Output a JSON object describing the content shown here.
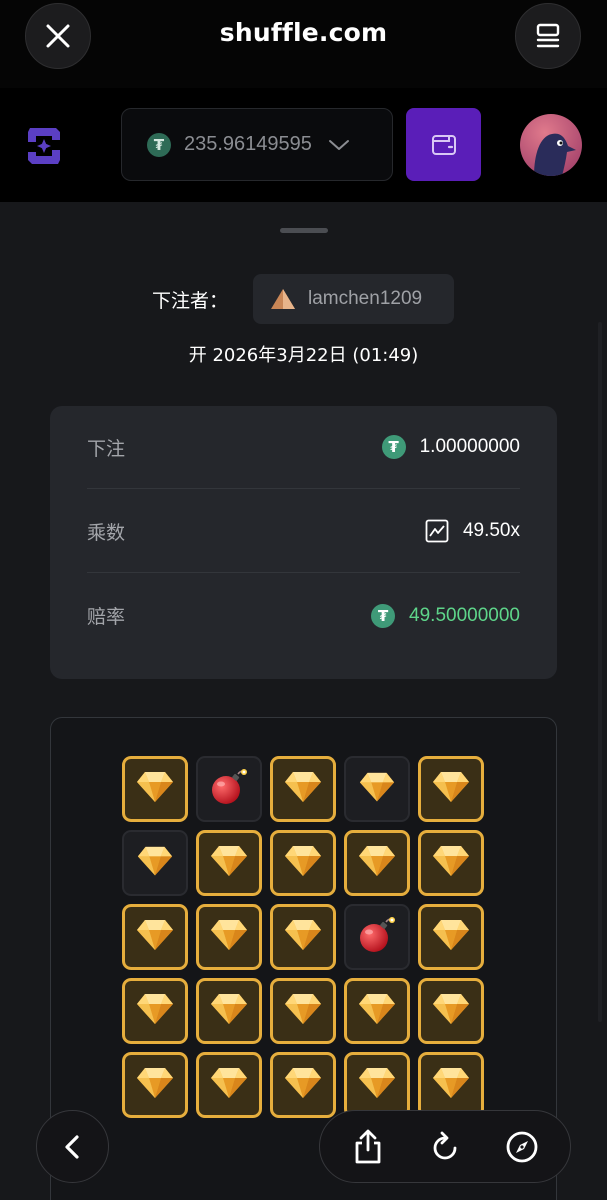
{
  "browser": {
    "url": "shuffle.com"
  },
  "header": {
    "balance": "235.96149595",
    "coin_symbol": "₮",
    "accent_color": "#5a1eb8"
  },
  "bet": {
    "bettor_label": "下注者：",
    "username": "lamchen1209",
    "date": "开 2026年3月22日 (01:49)",
    "stats": [
      {
        "label": "下注",
        "value": "1.00000000",
        "icon": "tether-coin-icon"
      },
      {
        "label": "乘数",
        "value": "49.50x",
        "icon": "chart-icon"
      },
      {
        "label": "赔率",
        "value": "49.50000000",
        "icon": "tether-coin-icon",
        "color": "#5ed58a"
      }
    ]
  },
  "board": {
    "columns": 5,
    "tiles": [
      "gem-picked",
      "bomb",
      "gem-picked",
      "gem",
      "gem-picked",
      "gem",
      "gem-picked",
      "gem-picked",
      "gem-picked",
      "gem-picked",
      "gem-picked",
      "gem-picked",
      "gem-picked",
      "bomb",
      "gem-picked",
      "gem-picked",
      "gem-picked",
      "gem-picked",
      "gem-picked",
      "gem-picked",
      "gem-picked",
      "gem-picked",
      "gem-picked",
      "gem-picked",
      "gem-picked"
    ]
  },
  "toolbar": {
    "icons": [
      "back-icon",
      "share-icon",
      "reload-icon",
      "compass-icon"
    ]
  }
}
